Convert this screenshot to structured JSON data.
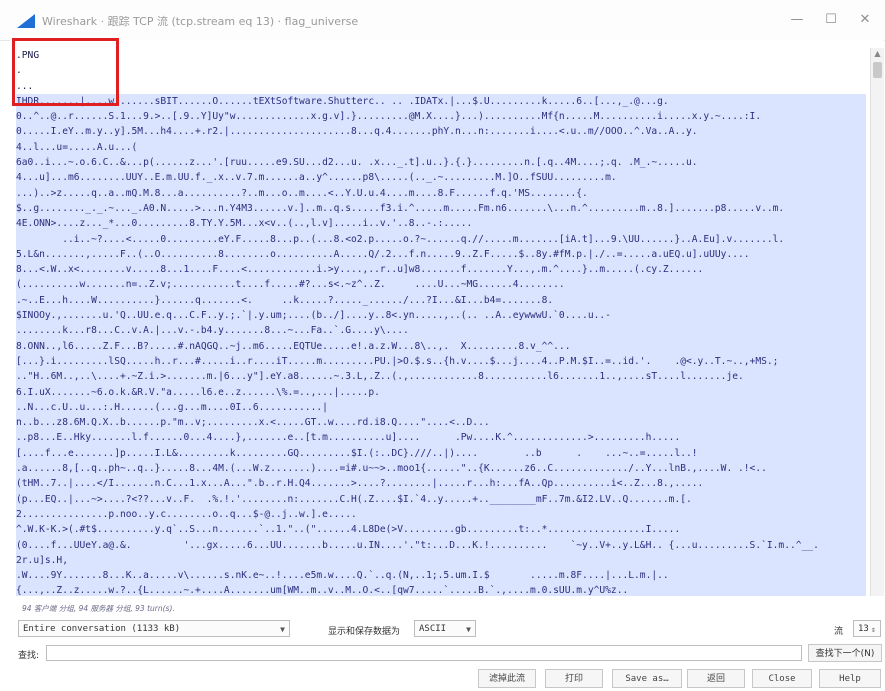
{
  "window": {
    "title": "Wireshark · 跟踪 TCP 流 (tcp.stream eq 13) · flag_universe",
    "min_glyph": "—",
    "max_glyph": "☐",
    "close_glyph": "✕"
  },
  "stream": {
    "lines": [
      ".PNG",
      ".",
      "...",
      "IHDR.......|....w.......sBIT......O......tEXtSoftware.Shutterc.. .. .IDATx.|...$.U.........k.....6..[...,_.@...g.",
      "0..^..@..r......S.1...9.>..[.9..Y]Uy\"w.............x.g.v].}.........@M.X....}...)..........Mf{n.....M..........i.....x.y.~....:I.",
      "0.....I.eY..m.y..y].5M...h4....+.r2.|.....................8...q.4.......phY.n...n:.......i....<.u..m//OOO..^.Va..A..y.",
      "4..l...u=.....A.u...(",
      "6a0..i...~.o.6.C..&...p(......z...'.[ruu.....e9.SU...d2...u. .x..._.t].u..}.{.}.........n.[.q..4M....;.q. .M_.~.....u.",
      "4...u]...m6........UUY..E.m.UU.f._.x..v.7.m......a..y^......p8\\.....(.._.~.........M.]O..fSUU.........m.",
      "...)..>z.....q..a..mQ.M.8...a..........?..m...o..m....<..Y.U.u.4....m....8.F......f.q.'MS........{.",
      "$..g........_._.~..._.A0.N.....>...n.Y4M3......v.]..m..q.s.....f3.i.^.....m.....Fm.n6.......\\...n.^.........m..8.].......p8.....v..m.",
      "4E.ONN>....z..._*...0.........8.TY.Y.5M...x<v..(..,l.v].....i..v.'..8..-.:.....",
      "        ..i..~?....<.....0.........eY.F.....8...p..(...8.<o2.p.....o.?~......q.//.....m.......[iA.t]...9.\\UU......}..A.Eu].v.......l.",
      "5.L&n.......,.....F..(..O..........8........o..........A.....Q/.2...f.n.....9..Z.F.....$..8y.#fM.p.|./..=.....a.uEQ.u].uUUy....",
      "8...<.W..x<........v.....8...1....F....<............i.>y....,..r..u]w8.......f.......Y...,.m.^....}..m.....(.cy.Z......",
      "(..........w.......n=..Z.v;...........t....f.....#?...s<.~z^..Z.     ....U...~MG......4........",
      ".~..E...h....W..........}......q.......<.     ..k.....?....._....../...?I...&I...b4=.......8.",
      "$INOOy.,.......u.'Q..UU.e.q...C.F..y.;.`|.y.um;....(b../]....y..8<.yn.....,..(.. ..A..eywwwU.`0....u..-",
      "........k...r8...C..v.A.|...v.-.b4.y.......8...~...Fa..`.G....y\\....",
      "8.ONN..,l6.....Z.F...B?.....#.nAQGQ..~j..m6.....EQTUe.....e!.a.z.W...8\\..,.  X.........8.v_^^...",
      "[...}.i.........lSQ.....h..r...#.....i..r....iT.....m.........PU.|>O.$.s..{h.v....$...j....4..P.M.$I..=..id.'.    .@<.y..T.~..,+MS.;",
      "..\"H..6M..,..\\....+.~Z.i.>.......m.|6...y\"].eY.a8......~.3.L,.Z..(.,............8...........l6.......1..,....sT....l.......je.",
      "6.I.uX.......~6.o.k.&R.V.\"a.....l6.e..z......\\%.=..,...|.....p.",
      "..N...c.U..u...:.H......(...g...m....0I..6...........|",
      "n..b...z8.6M.Q.X..b......p.\"m..v;.........x.<.....GT..w....rd.i8.Q....\"....<..D...",
      "..p8...E..Hky.......l.f......0...4....},.......e..[t.m..........u]....      .Pw....K.^.............>.........h.....",
      "[....f...e.......]p.....I.L&.........k.........GQ.........$I.(:..DC}.///..|)....        ..b      .    ...~..=.....l..!",
      ".a......8,[..q..ph~..q..}.....8...4M.(...W.z.......)....=i#.u~~>..moo1{......\"..{K......z6..C............./..Y...lnB.,....W. .!<..",
      "(tHM..7..|....</I.......n.C...1.x...A...\".b..r.H.Q4.......>....?........|.....r...h:...fA..Qp..........i<..Z...8.,.....",
      "(p...EQ..|...~>....?<??...v..F.  .%.!.'........n:.......C.H(.Z....$I.`4..y.....+..________mF..7m.&I2.LV..Q.......m.[.",
      "2...............p.noo..y.c........o..q...$-@..j..w.].e.....",
      "^.W.K-K.>(.#t$..........y.q`..S...n.......`..1.\"..(\"......4.L8De(>V.........gb.........t:..*.................I.....",
      "(0....f...UUeY.a@.&.         '...gx.....6...UU.......b.....u.IN....'.\"t:...D...K.!..........    `~y..V+..y.L&H.. {...u.........S.`I.m..^__.",
      "2r.u]s.H,",
      ".W....9Y.......8...K..a.....v\\......s.nK.e~..!....e5m.w....Q.`..q.(N,..1;.5.um.I.$       .....m.8F....|...L.m.|..",
      "{...,..Z..z.....w.?..{L......~.+....A.......um[WM..m..v..M..O.<..[qw7.....`.....B.`.,....m.0.sUU.m.y^U%z.."
    ],
    "summary": "94 客户端 分组, 94 服务器 分组, 93 turn(s)."
  },
  "controls": {
    "conversation_value": "Entire conversation (1133 kB)",
    "show_label": "显示和保存数据为",
    "format_value": "ASCII",
    "stream_label": "流",
    "stream_value": "13",
    "find_label": "查找:",
    "find_value": "",
    "find_next_label": "查找下一个(N)"
  },
  "buttons": {
    "filter_out": "滤掉此流",
    "print": "打印",
    "save_as": "Save as…",
    "back": "返回",
    "close": "Close",
    "help": "Help"
  }
}
